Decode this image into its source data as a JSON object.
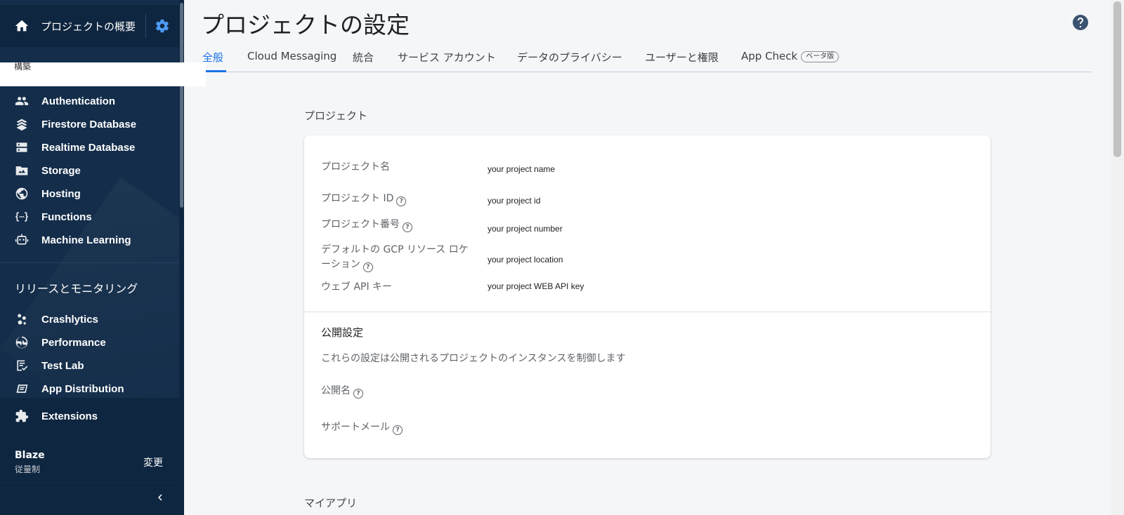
{
  "sidebar": {
    "project_overview": "プロジェクトの概要",
    "peek_text": "構築",
    "build_items": [
      {
        "label": "Authentication",
        "icon": "people-icon"
      },
      {
        "label": "Firestore Database",
        "icon": "firestore-icon"
      },
      {
        "label": "Realtime Database",
        "icon": "database-icon"
      },
      {
        "label": "Storage",
        "icon": "storage-icon"
      },
      {
        "label": "Hosting",
        "icon": "globe-icon"
      },
      {
        "label": "Functions",
        "icon": "functions-icon"
      },
      {
        "label": "Machine Learning",
        "icon": "robot-icon"
      }
    ],
    "release_section": "リリースとモニタリング",
    "release_items": [
      {
        "label": "Crashlytics",
        "icon": "crashlytics-icon"
      },
      {
        "label": "Performance",
        "icon": "performance-icon"
      },
      {
        "label": "Test Lab",
        "icon": "test-lab-icon"
      },
      {
        "label": "App Distribution",
        "icon": "app-distribution-icon"
      }
    ],
    "extensions": "Extensions",
    "plan_name": "Blaze",
    "plan_sub": "従量制",
    "plan_change": "変更"
  },
  "header": {
    "title": "プロジェクトの設定"
  },
  "tabs": [
    {
      "label": "全般",
      "active": true
    },
    {
      "label": "Cloud Messaging"
    },
    {
      "label": "統合"
    },
    {
      "label": "サービス アカウント"
    },
    {
      "label": "データのプライバシー"
    },
    {
      "label": "ユーザーと権限"
    },
    {
      "label": "App Check",
      "badge": "ベータ版"
    }
  ],
  "project_section": {
    "heading": "プロジェクト",
    "fields": [
      {
        "label": "プロジェクト名",
        "value": "your project name"
      },
      {
        "label": "プロジェクト ID",
        "value": "your project id"
      },
      {
        "label": "プロジェクト番号",
        "value": "your project number"
      },
      {
        "label_line1": "デフォルトの GCP リソース ロケ",
        "label_line2": "ーション",
        "value": "your project location"
      },
      {
        "label": "ウェブ API キー",
        "value": "your project WEB API key"
      }
    ],
    "public": {
      "title": "公開設定",
      "description": "これらの設定は公開されるプロジェクトのインスタンスを制御します",
      "public_name_label": "公開名",
      "support_email_label": "サポートメール"
    }
  },
  "my_apps_heading": "マイアプリ",
  "colors": {
    "sidebar_bg": "#132d4a",
    "accent": "#1a73e8",
    "gear": "#4d9bf5"
  }
}
